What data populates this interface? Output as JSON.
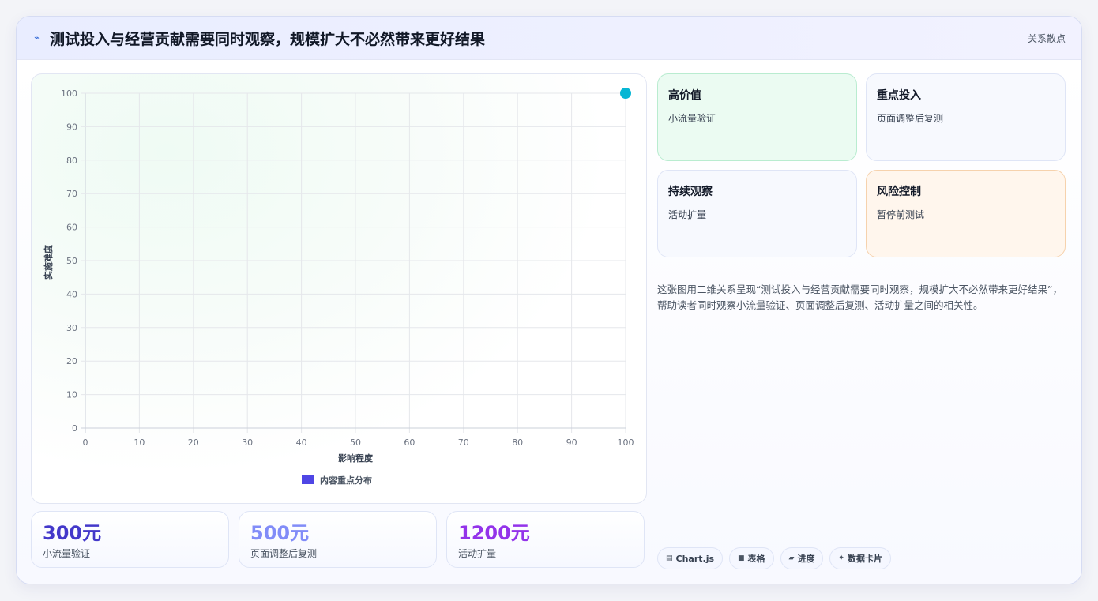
{
  "header": {
    "title": "测试投入与经营贡献需要同时观察，规模扩大不必然带来更好结果",
    "tag": "关系散点"
  },
  "chart_data": {
    "type": "scatter",
    "series": [
      {
        "name": "内容重点分布",
        "points": [
          {
            "x": 100,
            "y": 100
          }
        ],
        "color": "#06b6d4",
        "legend_color": "#4f46e5"
      }
    ],
    "xlabel": "影响程度",
    "ylabel": "实施难度",
    "xlim": [
      0,
      100
    ],
    "ylim": [
      0,
      100
    ],
    "xticks": [
      0,
      10,
      20,
      30,
      40,
      50,
      60,
      70,
      80,
      90,
      100
    ],
    "yticks": [
      0,
      10,
      20,
      30,
      40,
      50,
      60,
      70,
      80,
      90,
      100
    ],
    "grid": true,
    "legend_position": "bottom"
  },
  "stats": [
    {
      "value": "300元",
      "label": "小流量验证",
      "color": "#4338ca"
    },
    {
      "value": "500元",
      "label": "页面调整后复测",
      "color": "#818cf8"
    },
    {
      "value": "1200元",
      "label": "活动扩量",
      "color": "#9333ea"
    }
  ],
  "quadrants": [
    {
      "title": "高价值",
      "sub": "小流量验证"
    },
    {
      "title": "重点投入",
      "sub": "页面调整后复测"
    },
    {
      "title": "持续观察",
      "sub": "活动扩量"
    },
    {
      "title": "风险控制",
      "sub": "暂停前测试"
    }
  ],
  "description": "这张图用二维关系呈现“测试投入与经营贡献需要同时观察，规模扩大不必然带来更好结果”，帮助读者同时观察小流量验证、页面调整后复测、活动扩量之间的相关性。",
  "chips": [
    {
      "icon": "▤",
      "label": "Chart.js",
      "icon_name": "chart-icon"
    },
    {
      "icon": "■",
      "label": "表格",
      "icon_name": "table-icon"
    },
    {
      "icon": "▰",
      "label": "进度",
      "icon_name": "progress-icon"
    },
    {
      "icon": "✦",
      "label": "数据卡片",
      "icon_name": "sparkle-icon"
    }
  ],
  "colors": {
    "accent": "#4f46e5",
    "point": "#06b6d4",
    "grid": "#e5e7eb"
  }
}
